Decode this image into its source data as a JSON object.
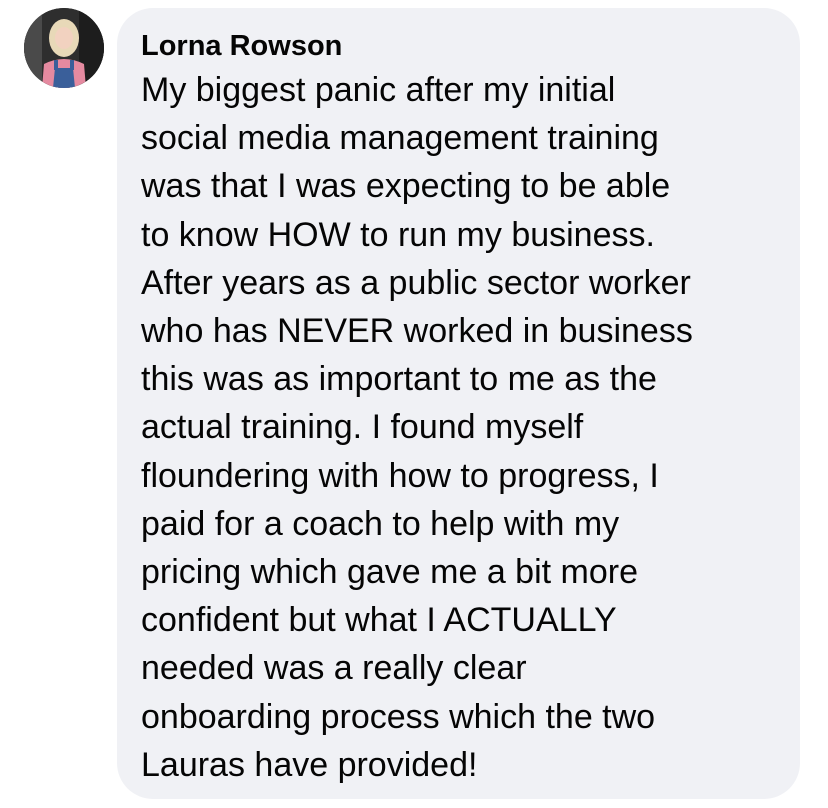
{
  "comment": {
    "author": "Lorna Rowson",
    "lines": [
      "My biggest panic after my initial",
      "social media management training",
      "was that I was expecting to be able",
      "to know HOW to run my business.",
      "After years as a public sector worker",
      "who has NEVER worked in business",
      "this was as important to me as the",
      "actual training. I found myself",
      "floundering with how to progress, I",
      "paid for a coach to help with my",
      "pricing which gave me a bit more",
      "confident but what I ACTUALLY",
      "needed was a really clear",
      "onboarding process which the two",
      "Lauras have provided!"
    ]
  },
  "colors": {
    "bubble_background": "#f0f1f5",
    "text": "#050505"
  }
}
